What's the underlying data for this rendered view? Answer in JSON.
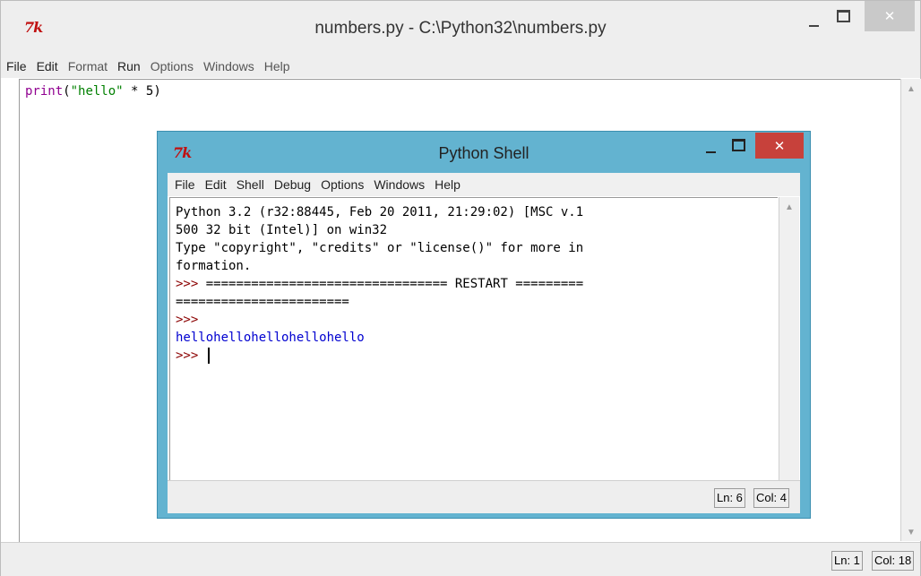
{
  "editor": {
    "title": "numbers.py - C:\\Python32\\numbers.py",
    "logo": "7k",
    "menu": [
      "File",
      "Edit",
      "Format",
      "Run",
      "Options",
      "Windows",
      "Help"
    ],
    "code": {
      "func": "print",
      "open": "(",
      "string": "\"hello\"",
      "rest": " * 5)"
    },
    "status": {
      "line": "Ln: 1",
      "col": "Col: 18"
    }
  },
  "shell": {
    "title": "Python Shell",
    "logo": "7k",
    "menu": [
      "File",
      "Edit",
      "Shell",
      "Debug",
      "Options",
      "Windows",
      "Help"
    ],
    "lines": {
      "l1": "Python 3.2 (r32:88445, Feb 20 2011, 21:29:02) [MSC v.1",
      "l2": "500 32 bit (Intel)] on win32",
      "l3": "Type \"copyright\", \"credits\" or \"license()\" for more in",
      "l4": "formation.",
      "prompt": ">>>",
      "restart_a": " ================================ RESTART =========",
      "restart_b": "=======================",
      "output": "hellohellohellohellohello"
    },
    "status": {
      "line": "Ln: 6",
      "col": "Col: 4"
    }
  },
  "icons": {
    "minimize": "minimize-icon",
    "maximize": "maximize-icon",
    "close": "close-icon",
    "scroll_up": "scroll-up-arrow-icon",
    "scroll_down": "scroll-down-arrow-icon"
  },
  "colors": {
    "shell_frame": "#63b3d0",
    "close_button": "#c7413b",
    "keyword": "#900090",
    "string": "#008000",
    "prompt": "#8b0000",
    "output": "#0000d0"
  }
}
